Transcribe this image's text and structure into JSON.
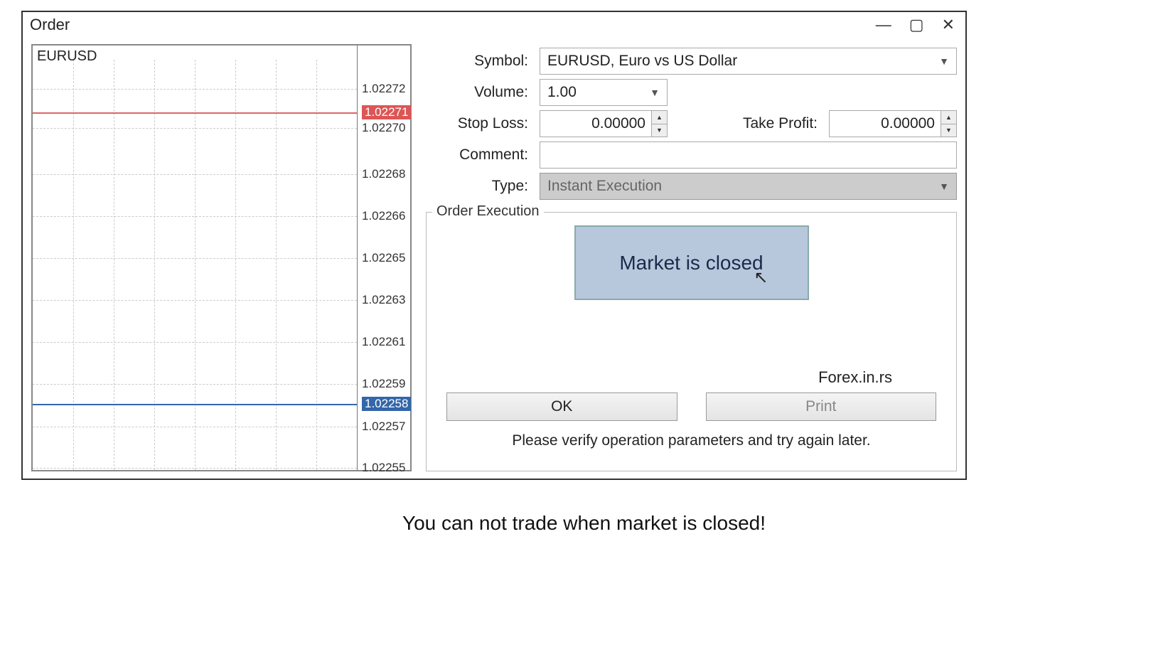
{
  "window_title": "Order",
  "chart": {
    "pair": "EURUSD",
    "ask": "1.02271",
    "bid": "1.02258",
    "ticks": [
      {
        "value": "1.02272",
        "y": 10.2
      },
      {
        "value": "1.02271",
        "y": 15.8,
        "badge": "ask"
      },
      {
        "value": "1.02270",
        "y": 19.5
      },
      {
        "value": "1.02268",
        "y": 30.3
      },
      {
        "value": "1.02266",
        "y": 40.2
      },
      {
        "value": "1.02265",
        "y": 50.0
      },
      {
        "value": "1.02263",
        "y": 60.0
      },
      {
        "value": "1.02261",
        "y": 69.8
      },
      {
        "value": "1.02259",
        "y": 79.7
      },
      {
        "value": "1.02258",
        "y": 84.4,
        "badge": "bid"
      },
      {
        "value": "1.02257",
        "y": 89.7
      },
      {
        "value": "1.02255",
        "y": 99.5
      }
    ]
  },
  "form": {
    "labels": {
      "symbol": "Symbol:",
      "volume": "Volume:",
      "stop_loss": "Stop Loss:",
      "take_profit": "Take Profit:",
      "comment": "Comment:",
      "type": "Type:"
    },
    "symbol": "EURUSD, Euro vs US Dollar",
    "volume": "1.00",
    "stop_loss": "0.00000",
    "take_profit": "0.00000",
    "comment": "",
    "type": "Instant Execution"
  },
  "execution": {
    "legend": "Order Execution",
    "status": "Market is closed",
    "ok": "OK",
    "print": "Print",
    "hint": "Please verify operation parameters and try again later."
  },
  "watermark": "Forex.in.rs",
  "caption": "You can not trade when market is closed!"
}
